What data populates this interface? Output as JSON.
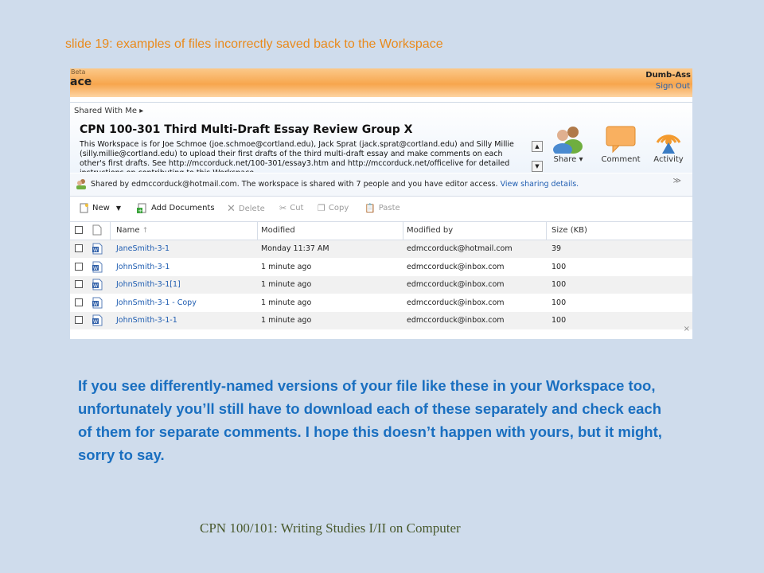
{
  "slide": {
    "title": "slide 19: examples of files incorrectly saved back to the Workspace",
    "body": "If you see differently-named versions of your file like these in your Workspace too, unfortunately you’ll still have to download each of these separately and check each of them for separate comments. I hope this doesn’t happen with yours, but it might, sorry to say.",
    "footer": "CPN 100/101: Writing Studies I/II on Computer"
  },
  "header": {
    "beta": "Beta",
    "brand": "ace",
    "user": "Dumb-Ass",
    "sign_out": "Sign Out"
  },
  "workspace": {
    "breadcrumb": "Shared With Me ▸",
    "title": "CPN 100-301 Third Multi-Draft Essay Review Group X",
    "description": "This Workspace is for Joe Schmoe (joe.schmoe@cortland.edu), Jack Sprat (jack.sprat@cortland.edu) and Silly Millie (silly.millie@cortland.edu) to upload their first drafts of the third multi-draft essay and make comments on each other's first drafts. See http://mccorduck.net/100-301/essay3.htm and http://mccorduck.net/officelive for detailed instructions on contributing to this Workspace.",
    "actions": {
      "share": "Share ▾",
      "comment": "Comment",
      "activity": "Activity"
    }
  },
  "sharing": {
    "text": "Shared by edmccorduck@hotmail.com. The workspace is shared with 7 people and you have editor access.",
    "link": "View sharing details."
  },
  "toolbar": {
    "new": "New",
    "add_documents": "Add Documents",
    "delete": "Delete",
    "cut": "Cut",
    "copy": "Copy",
    "paste": "Paste"
  },
  "table": {
    "headers": {
      "name": "Name",
      "sort": "↑",
      "modified": "Modified",
      "modified_by": "Modified by",
      "size": "Size (KB)"
    },
    "rows": [
      {
        "name": "JaneSmith-3-1",
        "modified": "Monday 11:37 AM",
        "modified_by": "edmccorduck@hotmail.com",
        "size": "39"
      },
      {
        "name": "JohnSmith-3-1",
        "modified": "1 minute ago",
        "modified_by": "edmccorduck@inbox.com",
        "size": "100"
      },
      {
        "name": "JohnSmith-3-1[1]",
        "modified": "1 minute ago",
        "modified_by": "edmccorduck@inbox.com",
        "size": "100"
      },
      {
        "name": "JohnSmith-3-1 - Copy",
        "modified": "1 minute ago",
        "modified_by": "edmccorduck@inbox.com",
        "size": "100"
      },
      {
        "name": "JohnSmith-3-1-1",
        "modified": "1 minute ago",
        "modified_by": "edmccorduck@inbox.com",
        "size": "100"
      }
    ]
  },
  "close_glyph": "×",
  "collapse_glyph": "≫"
}
